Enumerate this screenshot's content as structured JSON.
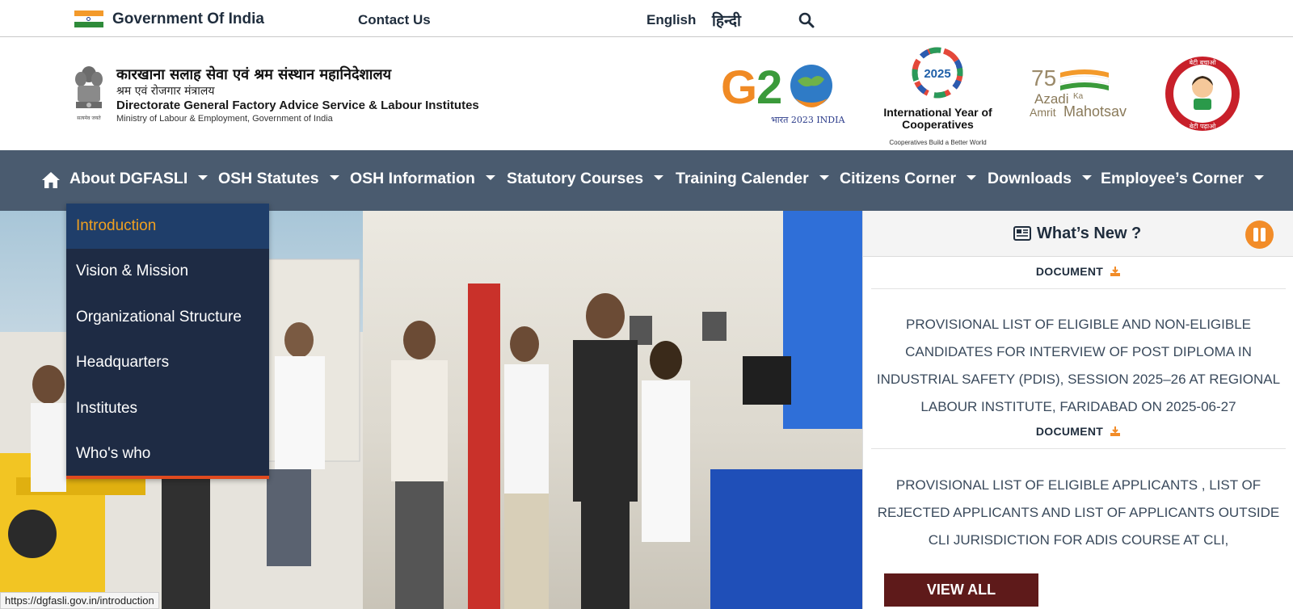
{
  "topbar": {
    "gov_name": "Government Of India",
    "contact": "Contact Us",
    "lang_en": "English",
    "lang_hi": "हिन्दी",
    "search_icon": "search-icon"
  },
  "header": {
    "hindi_title": "कारखाना सलाह सेवा एवं श्रम संस्थान महानिदेशालय",
    "hindi_ministry": "श्रम एवं रोजगार मंत्रालय",
    "english_title": "Directorate General Factory Advice Service & Labour Institutes",
    "english_ministry": "Ministry of Labour & Employment, Government of India",
    "emblem_caption": "सत्यमेव जयते",
    "g20_subtitle": "भारत 2023 INDIA",
    "coop_logo_year": "2025",
    "coop_title": "International Year of Cooperatives",
    "coop_tagline": "Cooperatives Build a Better World",
    "azadi_75": "75",
    "azadi_text1": "Azadi",
    "azadi_text2": "Ka",
    "azadi_text3": "Amrit",
    "azadi_text4": "Mahotsav",
    "bbbp_top": "बेटी बचाओ",
    "bbbp_bottom": "बेटी पढ़ाओ"
  },
  "nav": {
    "items": [
      {
        "label": "About DGFASLI"
      },
      {
        "label": "OSH Statutes"
      },
      {
        "label": "OSH Information"
      },
      {
        "label": "Statutory Courses"
      },
      {
        "label": "Training Calender"
      },
      {
        "label": "Citizens Corner"
      },
      {
        "label": "Downloads"
      },
      {
        "label": "Employee’s Corner"
      }
    ]
  },
  "dropdown": {
    "items": [
      {
        "label": "Introduction"
      },
      {
        "label": "Vision & Mission"
      },
      {
        "label": "Organizational Structure"
      },
      {
        "label": "Headquarters"
      },
      {
        "label": "Institutes"
      },
      {
        "label": "Who's who"
      }
    ]
  },
  "whats_new": {
    "title": "What’s New ?",
    "entries": [
      {
        "tag": "DOCUMENT",
        "text": "PROVISIONAL LIST OF ELIGIBLE AND NON-ELIGIBLE CANDIDATES FOR INTERVIEW OF POST DIPLOMA IN INDUSTRIAL SAFETY (PDIS), SESSION 2025–26 AT REGIONAL LABOUR INSTITUTE, FARIDABAD ON 2025-06-27"
      },
      {
        "tag": "DOCUMENT",
        "text": "PROVISIONAL LIST OF ELIGIBLE APPLICANTS , LIST OF REJECTED APPLICANTS AND LIST OF APPLICANTS OUTSIDE CLI JURISDICTION FOR ADIS COURSE AT CLI,"
      }
    ],
    "view_all": "VIEW ALL"
  },
  "status_url": "https://dgfasli.gov.in/introduction",
  "colors": {
    "nav_bg": "#4a5b6f",
    "dropdown_bg": "#1e2b44",
    "dropdown_active": "#f0a020",
    "pause_orange": "#f28c28",
    "view_all_bg": "#5e1a1a"
  }
}
